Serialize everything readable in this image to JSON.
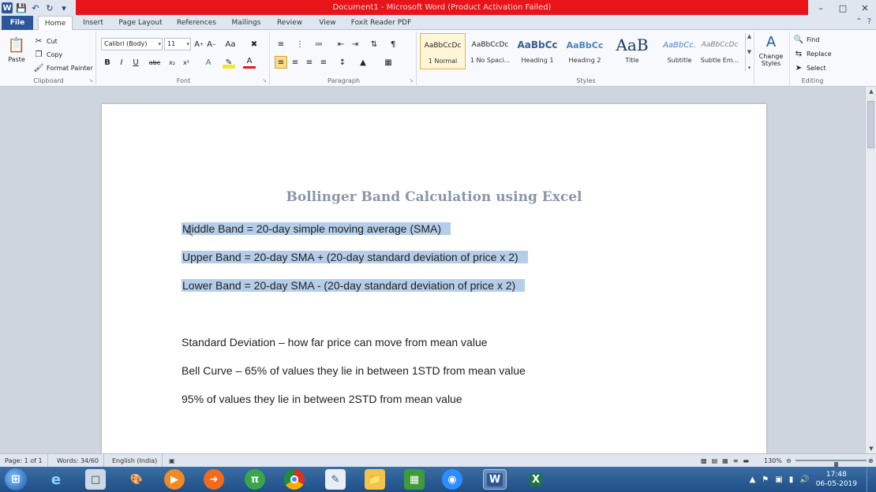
{
  "window": {
    "title": "Document1 - Microsoft Word (Product Activation Failed)",
    "minimize": "–",
    "maximize": "□",
    "close": "✕"
  },
  "tabs": {
    "file": "File",
    "items": [
      "Home",
      "Insert",
      "Page Layout",
      "References",
      "Mailings",
      "Review",
      "View",
      "Foxit Reader PDF"
    ],
    "active": "Home"
  },
  "ribbon": {
    "clipboard": {
      "label": "Clipboard",
      "paste": "Paste",
      "cut": "Cut",
      "copy": "Copy",
      "format_painter": "Format Painter"
    },
    "font": {
      "label": "Font",
      "family": "Calibri (Body)",
      "size": "11"
    },
    "paragraph": {
      "label": "Paragraph"
    },
    "styles": {
      "label": "Styles",
      "items": [
        {
          "preview": "AaBbCcDc",
          "name": "1 Normal"
        },
        {
          "preview": "AaBbCcDc",
          "name": "1 No Spaci..."
        },
        {
          "preview": "AaBbCc",
          "name": "Heading 1"
        },
        {
          "preview": "AaBbCc",
          "name": "Heading 2"
        },
        {
          "preview": "AaB",
          "name": "Title"
        },
        {
          "preview": "AaBbCc.",
          "name": "Subtitle"
        },
        {
          "preview": "AaBbCcDc",
          "name": "Subtle Em..."
        }
      ],
      "change_styles": "Change Styles"
    },
    "editing": {
      "label": "Editing",
      "find": "Find",
      "replace": "Replace",
      "select": "Select"
    }
  },
  "document": {
    "title": "Bollinger Band Calculation using Excel",
    "lines": [
      "Middle Band = 20-day simple moving average (SMA)",
      "Upper Band = 20-day SMA + (20-day standard deviation of price x 2)",
      "Lower Band = 20-day SMA - (20-day standard deviation of price x 2)",
      "Standard Deviation – how far price can move from mean value",
      "Bell Curve – 65% of values they lie in between 1STD from mean value",
      "95% of values they lie in between 2STD from mean value"
    ]
  },
  "status": {
    "page": "Page: 1 of 1",
    "words": "Words: 34/60",
    "language": "English (India)",
    "zoom": "130%",
    "zoom_fraction": 0.57
  },
  "taskbar": {
    "time": "17:48",
    "date": "06-05-2019"
  },
  "colors": {
    "title_bar_alert": "#e8141a",
    "file_tab": "#2b579a",
    "selection": "#b4cde8"
  }
}
